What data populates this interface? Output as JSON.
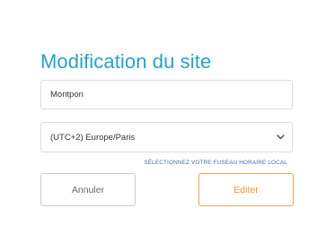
{
  "dialog": {
    "title": "Modification du site",
    "site_name": {
      "value": "Montpon"
    },
    "timezone": {
      "selected": "(UTC+2) Europe/Paris",
      "hint": "SÉLECTIONNEZ VOTRE FUSEAU HORAIRE LOCAL"
    },
    "buttons": {
      "cancel_label": "Annuler",
      "edit_label": "Editer"
    }
  },
  "colors": {
    "title": "#2aa0c8",
    "hint": "#3f6fb0",
    "edit_accent": "#ef8f2f",
    "border": "#d9dde1"
  },
  "icons": {
    "select_arrow": "chevron-down-icon"
  }
}
